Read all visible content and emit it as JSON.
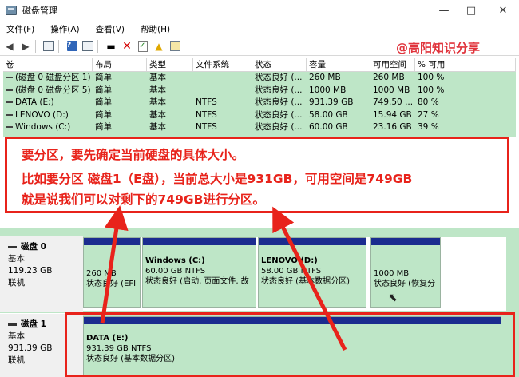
{
  "window": {
    "title": "磁盘管理",
    "min": "—",
    "max": "□",
    "close": "✕"
  },
  "menu": [
    "文件(F)",
    "操作(A)",
    "查看(V)",
    "帮助(H)"
  ],
  "toolbar_icons": [
    "back-arrow-icon",
    "forward-arrow-icon",
    "console-tree-icon",
    "help-icon",
    "list-view-icon",
    "connect-icon",
    "delete-icon",
    "check-icon",
    "folder-up-icon",
    "search-icon"
  ],
  "watermark": "@高阳知识分享",
  "volumes": {
    "headers": [
      "卷",
      "布局",
      "类型",
      "文件系统",
      "状态",
      "容量",
      "可用空间",
      "% 可用"
    ],
    "rows": [
      [
        "(磁盘 0 磁盘分区 1)",
        "简单",
        "基本",
        "",
        "状态良好 (...",
        "260 MB",
        "260 MB",
        "100 %"
      ],
      [
        "(磁盘 0 磁盘分区 5)",
        "简单",
        "基本",
        "",
        "状态良好 (...",
        "1000 MB",
        "1000 MB",
        "100 %"
      ],
      [
        "DATA (E:)",
        "简单",
        "基本",
        "NTFS",
        "状态良好 (...",
        "931.39 GB",
        "749.50 ...",
        "80 %"
      ],
      [
        "LENOVO (D:)",
        "简单",
        "基本",
        "NTFS",
        "状态良好 (...",
        "58.00 GB",
        "15.94 GB",
        "27 %"
      ],
      [
        "Windows (C:)",
        "简单",
        "基本",
        "NTFS",
        "状态良好 (...",
        "60.00 GB",
        "23.16 GB",
        "39 %"
      ]
    ]
  },
  "callout": {
    "line1": "要分区，要先确定当前硬盘的具体大小。",
    "line2": "比如要分区 磁盘1（E盘），当前总大小是931GB，可用空间是749GB",
    "line3": "就是说我们可以对剩下的749GB进行分区。"
  },
  "disks": [
    {
      "name": "磁盘 0",
      "type": "基本",
      "size": "119.23 GB",
      "status": "联机"
    },
    {
      "name": "磁盘 1",
      "type": "基本",
      "size": "931.39 GB",
      "status": "联机"
    }
  ],
  "disk0_parts": [
    {
      "name": "",
      "size": "260 MB",
      "status": "状态良好 (EFI"
    },
    {
      "name": "Windows  (C:)",
      "size": "60.00 GB NTFS",
      "status": "状态良好 (启动, 页面文件, 故"
    },
    {
      "name": "LENOVO  (D:)",
      "size": "58.00 GB NTFS",
      "status": "状态良好 (基本数据分区)"
    },
    {
      "name": "",
      "size": "1000 MB",
      "status": "状态良好 (恢复分"
    }
  ],
  "disk1_parts": [
    {
      "name": "DATA  (E:)",
      "size": "931.39 GB NTFS",
      "status": "状态良好 (基本数据分区)"
    }
  ],
  "colors": {
    "accent_red": "#e8231b",
    "row_green": "#bee6c7",
    "partition_stripe": "#1b2c8f"
  }
}
